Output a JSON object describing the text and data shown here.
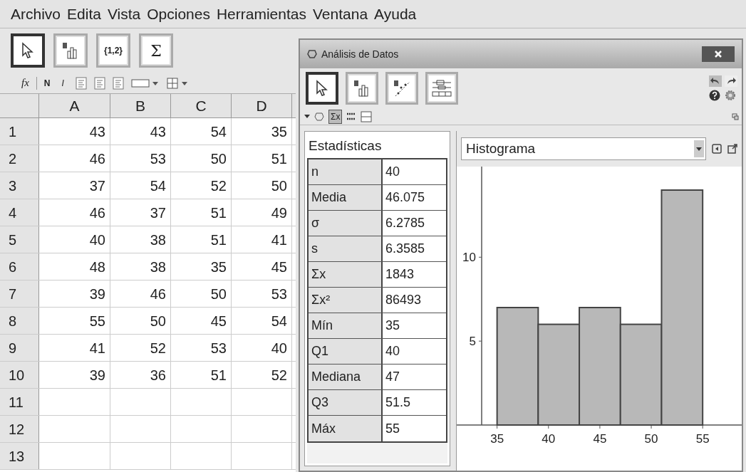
{
  "menu": [
    "Archivo",
    "Edita",
    "Vista",
    "Opciones",
    "Herramientas",
    "Ventana",
    "Ayuda"
  ],
  "toolbar": [
    {
      "kind": "pointer",
      "selected": true
    },
    {
      "kind": "chart",
      "selected": false
    },
    {
      "kind": "text",
      "label": "{1,2}",
      "selected": false
    },
    {
      "kind": "text",
      "label": "Σ",
      "selected": false
    }
  ],
  "format_bar": {
    "formula": "fx",
    "bold": "N",
    "italic": "I"
  },
  "spreadsheet": {
    "columns": [
      "A",
      "B",
      "C",
      "D"
    ],
    "rows": [
      {
        "label": "1",
        "cells": [
          "43",
          "43",
          "54",
          "35"
        ]
      },
      {
        "label": "2",
        "cells": [
          "46",
          "53",
          "50",
          "51"
        ]
      },
      {
        "label": "3",
        "cells": [
          "37",
          "54",
          "52",
          "50"
        ]
      },
      {
        "label": "4",
        "cells": [
          "46",
          "37",
          "51",
          "49"
        ]
      },
      {
        "label": "5",
        "cells": [
          "40",
          "38",
          "51",
          "41"
        ]
      },
      {
        "label": "6",
        "cells": [
          "48",
          "38",
          "35",
          "45"
        ]
      },
      {
        "label": "7",
        "cells": [
          "39",
          "46",
          "50",
          "53"
        ]
      },
      {
        "label": "8",
        "cells": [
          "55",
          "50",
          "45",
          "54"
        ]
      },
      {
        "label": "9",
        "cells": [
          "41",
          "52",
          "53",
          "40"
        ]
      },
      {
        "label": "10",
        "cells": [
          "39",
          "36",
          "51",
          "52"
        ]
      },
      {
        "label": "11"
      },
      {
        "label": "12"
      },
      {
        "label": "13"
      }
    ]
  },
  "analysis_window": {
    "title": "Análisis de Datos",
    "toolbar": [
      {
        "kind": "pointer",
        "selected": true
      },
      {
        "kind": "histogram",
        "selected": false
      },
      {
        "kind": "scatter",
        "selected": false
      },
      {
        "kind": "boxplot",
        "selected": false
      }
    ],
    "view_bar": {
      "stats_button": "Σx",
      "stats_selected": true
    },
    "statistics": {
      "title": "Estadísticas",
      "rows": [
        {
          "label": "n",
          "value": "40"
        },
        {
          "label": "Media",
          "value": "46.075"
        },
        {
          "label": "σ",
          "value": "6.2785"
        },
        {
          "label": "s",
          "value": "6.3585"
        },
        {
          "label": "Σx",
          "value": "1843"
        },
        {
          "label": "Σx²",
          "value": "86493"
        },
        {
          "label": "Mín",
          "value": "35"
        },
        {
          "label": "Q1",
          "value": "40"
        },
        {
          "label": "Mediana",
          "value": "47"
        },
        {
          "label": "Q3",
          "value": "51.5"
        },
        {
          "label": "Máx",
          "value": "55"
        }
      ]
    },
    "plot": {
      "type_select": "Histograma",
      "chart_data": {
        "type": "bar",
        "x": [
          37,
          41,
          45,
          49,
          53
        ],
        "values": [
          7,
          6,
          7,
          6,
          14
        ],
        "xlim": [
          33.5,
          58.8
        ],
        "ylim": [
          0,
          15.4
        ],
        "xticks": [
          35,
          40,
          45,
          50,
          55
        ],
        "yticks": [
          5,
          10
        ]
      }
    }
  }
}
